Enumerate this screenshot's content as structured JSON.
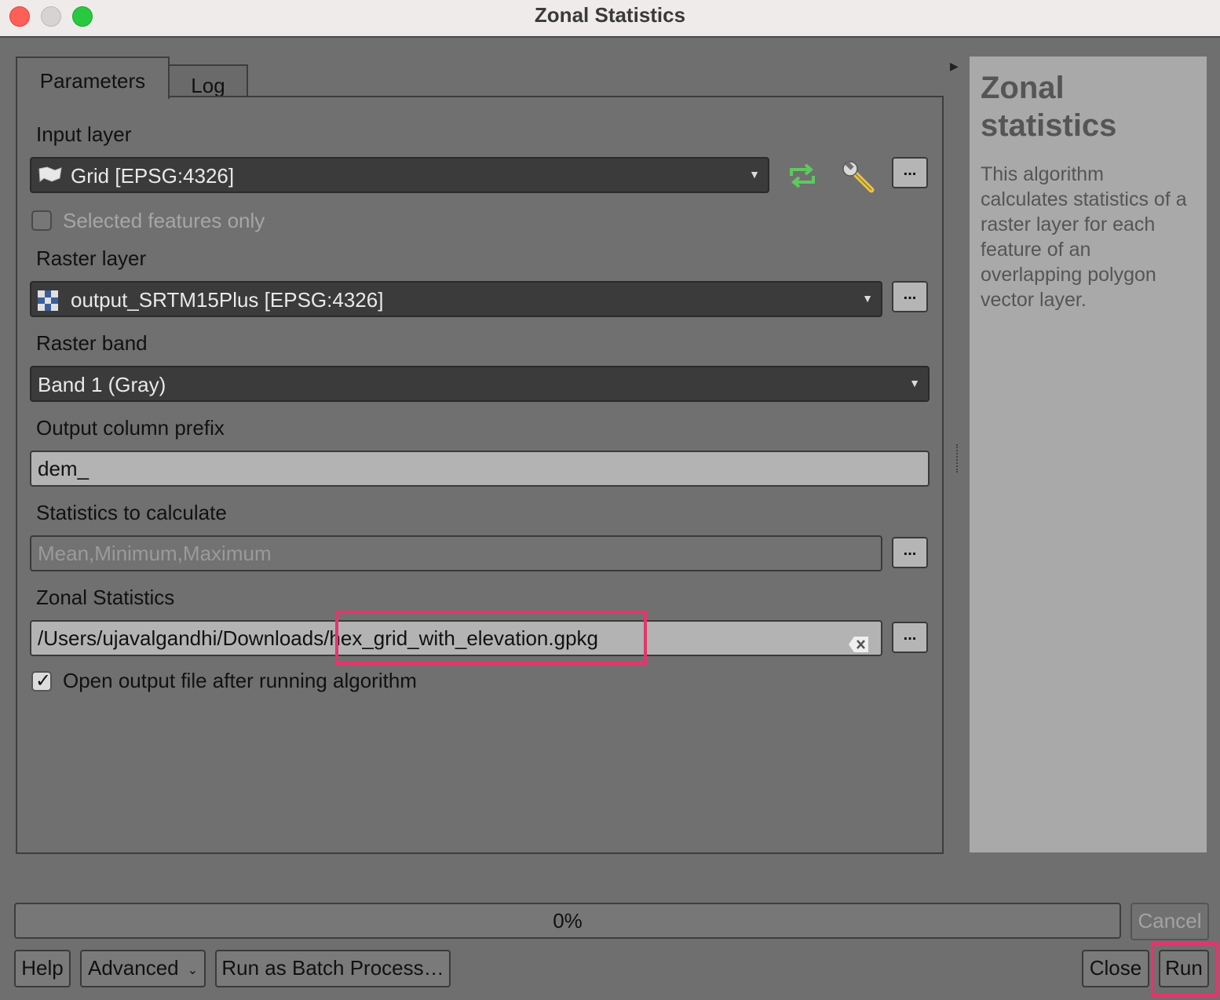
{
  "window": {
    "title": "Zonal Statistics"
  },
  "tabs": [
    {
      "label": "Parameters"
    },
    {
      "label": "Log"
    }
  ],
  "params": {
    "input_layer": {
      "label": "Input layer",
      "value": "Grid [EPSG:4326]"
    },
    "selected_only": {
      "label": "Selected features only",
      "checked": false
    },
    "raster_layer": {
      "label": "Raster layer",
      "value": "output_SRTM15Plus [EPSG:4326]"
    },
    "raster_band": {
      "label": "Raster band",
      "value": "Band 1 (Gray)"
    },
    "prefix": {
      "label": "Output column prefix",
      "value": "dem_"
    },
    "statistics": {
      "label": "Statistics to calculate",
      "value": "Mean,Minimum,Maximum"
    },
    "output": {
      "label": "Zonal Statistics",
      "value": "/Users/ujavalgandhi/Downloads/hex_grid_with_elevation.gpkg"
    },
    "open_output": {
      "label": "Open output file after running algorithm",
      "checked": true
    },
    "browse_label": "..."
  },
  "help": {
    "title": "Zonal statistics",
    "description": "This algorithm calculates statistics of a raster layer for each feature of an overlapping polygon vector layer."
  },
  "footer": {
    "progress_text": "0%",
    "progress_value": 0,
    "cancel": "Cancel",
    "help": "Help",
    "advanced": "Advanced",
    "batch": "Run as Batch Process…",
    "close": "Close",
    "run": "Run"
  }
}
